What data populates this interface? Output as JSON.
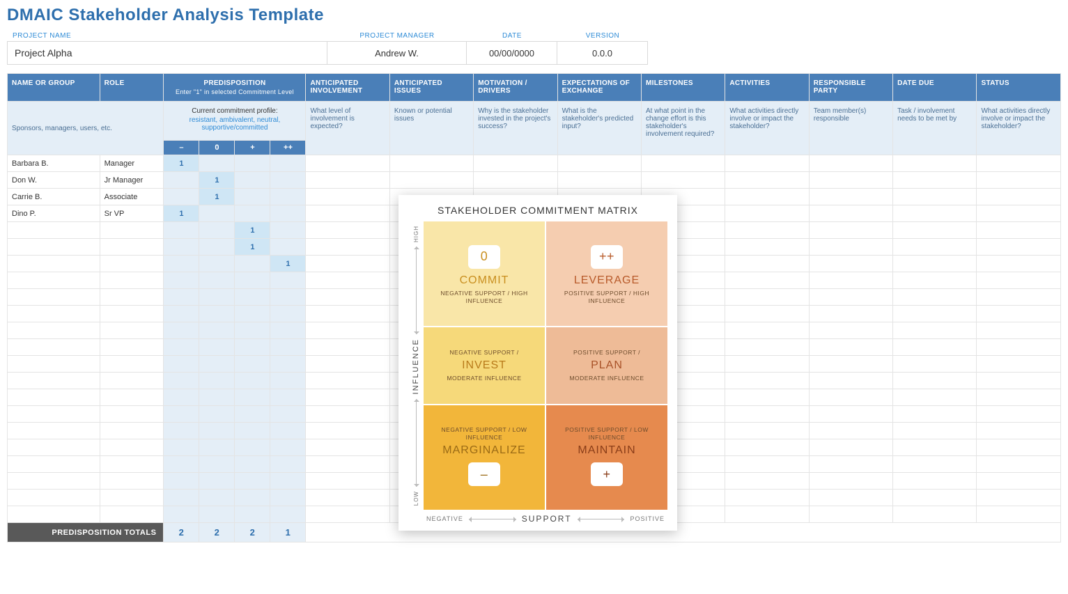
{
  "title": "DMAIC Stakeholder Analysis Template",
  "header": {
    "project_name_label": "PROJECT NAME",
    "project_name": "Project Alpha",
    "project_manager_label": "PROJECT MANAGER",
    "project_manager": "Andrew W.",
    "date_label": "DATE",
    "date": "00/00/0000",
    "version_label": "VERSION",
    "version": "0.0.0"
  },
  "columns": {
    "name": "NAME OR GROUP",
    "role": "ROLE",
    "predisposition": "PREDISPOSITION",
    "predisposition_sub": "Enter \"1\" in selected Commitment Level",
    "involvement": "ANTICIPATED INVOLVEMENT",
    "issues": "ANTICIPATED ISSUES",
    "motivation": "MOTIVATION / DRIVERS",
    "expectations": "EXPECTATIONS OF EXCHANGE",
    "milestones": "MILESTONES",
    "activities": "ACTIVITIES",
    "responsible": "RESPONSIBLE PARTY",
    "due": "DATE DUE",
    "status": "STATUS"
  },
  "subhead": {
    "name_hint": "Sponsors, managers, users, etc.",
    "profile_line1": "Current commitment profile:",
    "profile_line2": "resistant, ambivalent, neutral, supportive/committed",
    "involvement": "What level of involvement is expected?",
    "issues": "Known or potential issues",
    "motivation": "Why is the stakeholder invested in the project's success?",
    "expectations": "What is the stakeholder's predicted input?",
    "milestones": "At what point in the change effort is this stakeholder's involvement required?",
    "activities": "What activities directly involve or impact the stakeholder?",
    "responsible": "Team member(s) responsible",
    "due": "Task / involvement needs to be met by",
    "status": "What activities directly involve or impact the stakeholder?"
  },
  "pred_levels": [
    "–",
    "0",
    "+",
    "++"
  ],
  "rows": [
    {
      "name": "Barbara B.",
      "role": "Manager",
      "pred": [
        1,
        null,
        null,
        null
      ]
    },
    {
      "name": "Don W.",
      "role": "Jr Manager",
      "pred": [
        null,
        1,
        null,
        null
      ]
    },
    {
      "name": "Carrie B.",
      "role": "Associate",
      "pred": [
        null,
        1,
        null,
        null
      ]
    },
    {
      "name": "Dino P.",
      "role": "Sr VP",
      "pred": [
        1,
        null,
        null,
        null
      ]
    },
    {
      "name": "",
      "role": "",
      "pred": [
        null,
        null,
        1,
        null
      ]
    },
    {
      "name": "",
      "role": "",
      "pred": [
        null,
        null,
        1,
        null
      ]
    },
    {
      "name": "",
      "role": "",
      "pred": [
        null,
        null,
        null,
        1
      ]
    },
    {
      "name": "",
      "role": "",
      "pred": [
        null,
        null,
        null,
        null
      ]
    },
    {
      "name": "",
      "role": "",
      "pred": [
        null,
        null,
        null,
        null
      ]
    },
    {
      "name": "",
      "role": "",
      "pred": [
        null,
        null,
        null,
        null
      ]
    },
    {
      "name": "",
      "role": "",
      "pred": [
        null,
        null,
        null,
        null
      ]
    },
    {
      "name": "",
      "role": "",
      "pred": [
        null,
        null,
        null,
        null
      ]
    },
    {
      "name": "",
      "role": "",
      "pred": [
        null,
        null,
        null,
        null
      ]
    },
    {
      "name": "",
      "role": "",
      "pred": [
        null,
        null,
        null,
        null
      ]
    },
    {
      "name": "",
      "role": "",
      "pred": [
        null,
        null,
        null,
        null
      ]
    },
    {
      "name": "",
      "role": "",
      "pred": [
        null,
        null,
        null,
        null
      ]
    },
    {
      "name": "",
      "role": "",
      "pred": [
        null,
        null,
        null,
        null
      ]
    },
    {
      "name": "",
      "role": "",
      "pred": [
        null,
        null,
        null,
        null
      ]
    },
    {
      "name": "",
      "role": "",
      "pred": [
        null,
        null,
        null,
        null
      ]
    },
    {
      "name": "",
      "role": "",
      "pred": [
        null,
        null,
        null,
        null
      ]
    },
    {
      "name": "",
      "role": "",
      "pred": [
        null,
        null,
        null,
        null
      ]
    },
    {
      "name": "",
      "role": "",
      "pred": [
        null,
        null,
        null,
        null
      ]
    }
  ],
  "totals_label": "PREDISPOSITION TOTALS",
  "totals": [
    2,
    2,
    2,
    1
  ],
  "matrix": {
    "title": "STAKEHOLDER COMMITMENT MATRIX",
    "y_label": "INFLUENCE",
    "y_high": "HIGH",
    "y_low": "LOW",
    "x_label": "SUPPORT",
    "x_neg": "NEGATIVE",
    "x_pos": "POSITIVE",
    "cells": {
      "commit": {
        "symbol": "0",
        "title": "COMMIT",
        "desc": "NEGATIVE SUPPORT / HIGH INFLUENCE"
      },
      "leverage": {
        "symbol": "++",
        "title": "LEVERAGE",
        "desc": "POSITIVE SUPPORT / HIGH INFLUENCE"
      },
      "invest": {
        "top": "NEGATIVE SUPPORT /",
        "title": "INVEST",
        "desc": "MODERATE INFLUENCE"
      },
      "plan": {
        "top": "POSITIVE SUPPORT /",
        "title": "PLAN",
        "desc": "MODERATE INFLUENCE"
      },
      "marginalize": {
        "top": "NEGATIVE SUPPORT / LOW INFLUENCE",
        "title": "MARGINALIZE",
        "symbol": "–"
      },
      "maintain": {
        "top": "POSITIVE SUPPORT / LOW INFLUENCE",
        "title": "MAINTAIN",
        "symbol": "+"
      }
    }
  }
}
